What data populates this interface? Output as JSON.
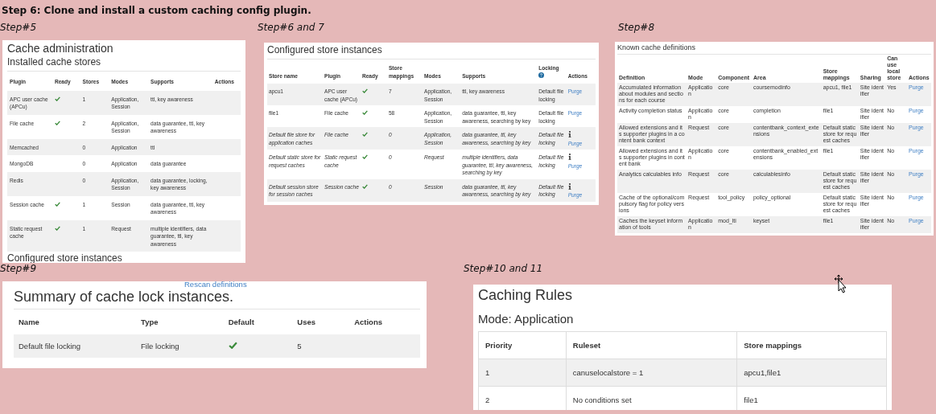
{
  "heading": "Step 6: Clone and install a custom caching config plugin.",
  "step5": {
    "label": "Step#5",
    "title": "Cache administration",
    "subtitle": "Installed cache stores",
    "columns": [
      "Plugin",
      "Ready",
      "Stores",
      "Modes",
      "Supports",
      "Actions"
    ],
    "rows": [
      {
        "plugin": "APC user cache (APCu)",
        "ready": true,
        "stores": "1",
        "modes": "Application, Session",
        "supports": "ttl, key awareness"
      },
      {
        "plugin": "File cache",
        "ready": true,
        "stores": "2",
        "modes": "Application, Session",
        "supports": "data guarantee, ttl, key awareness"
      },
      {
        "plugin": "Memcached",
        "ready": false,
        "stores": "0",
        "modes": "Application",
        "supports": "ttl"
      },
      {
        "plugin": "MongoDB",
        "ready": false,
        "stores": "0",
        "modes": "Application",
        "supports": "data guarantee"
      },
      {
        "plugin": "Redis",
        "ready": false,
        "stores": "0",
        "modes": "Application, Session",
        "supports": "data guarantee, locking, key awareness"
      },
      {
        "plugin": "Session cache",
        "ready": true,
        "stores": "1",
        "modes": "Session",
        "supports": "data guarantee, ttl, key awareness"
      },
      {
        "plugin": "Static request cache",
        "ready": true,
        "stores": "1",
        "modes": "Request",
        "supports": "multiple identifiers, data guarantee, ttl, key awareness"
      }
    ],
    "next_title": "Configured store instances"
  },
  "step6_7": {
    "label": "Step#6 and 7",
    "title": "Configured store instances",
    "columns": [
      "Store name",
      "Plugin",
      "Ready",
      "Store mappings",
      "Modes",
      "Supports",
      "Locking",
      "Actions"
    ],
    "rows": [
      {
        "name": "apcu1",
        "plugin": "APC user cache (APCu)",
        "ready": true,
        "mappings": "7",
        "modes": "Application, Session",
        "supports": "ttl, key awareness",
        "locking": "Default file locking",
        "action": "Purge",
        "is_default": false
      },
      {
        "name": "file1",
        "plugin": "File cache",
        "ready": true,
        "mappings": "58",
        "modes": "Application, Session",
        "supports": "data guarantee, ttl, key awareness, searching by key",
        "locking": "Default file locking",
        "action": "Purge",
        "is_default": false
      },
      {
        "name": "Default file store for application caches",
        "plugin": "File cache",
        "ready": true,
        "mappings": "0",
        "modes": "Application, Session",
        "supports": "data guarantee, ttl, key awareness, searching by key",
        "locking": "Default file locking",
        "action": "Purge",
        "is_default": true
      },
      {
        "name": "Default static store for request caches",
        "plugin": "Static request cache",
        "ready": true,
        "mappings": "0",
        "modes": "Request",
        "supports": "multiple identifiers, data guarantee, ttl, key awareness, searching by key",
        "locking": "Default file locking",
        "action": "Purge",
        "is_default": true
      },
      {
        "name": "Default session store for session caches",
        "plugin": "Session cache",
        "ready": true,
        "mappings": "0",
        "modes": "Session",
        "supports": "data guarantee, ttl, key awareness, searching by key",
        "locking": "Default file locking",
        "action": "Purge",
        "is_default": true
      }
    ]
  },
  "step8": {
    "label": "Step#8",
    "title": "Known cache definitions",
    "columns": [
      "Definition",
      "Mode",
      "Component",
      "Area",
      "Store mappings",
      "Sharing",
      "Can use local store",
      "Actions"
    ],
    "rows": [
      {
        "definition": "Accumulated information about modules and sections for each course",
        "mode": "Application",
        "component": "core",
        "area": "coursemodinfo",
        "mappings": "apcu1, file1",
        "sharing": "Site identifier",
        "local": "Yes",
        "action": "Purge"
      },
      {
        "definition": "Activity completion status",
        "mode": "Application",
        "component": "core",
        "area": "completion",
        "mappings": "file1",
        "sharing": "Site identifier",
        "local": "No",
        "action": "Purge"
      },
      {
        "definition": "Allowed extensions and its supporter plugins in a content bank context",
        "mode": "Request",
        "component": "core",
        "area": "contentbank_context_extensions",
        "mappings": "Default static store for request caches",
        "sharing": "Site identifier",
        "local": "No",
        "action": "Purge"
      },
      {
        "definition": "Allowed extensions and its supporter plugins in content bank",
        "mode": "Application",
        "component": "core",
        "area": "contentbank_enabled_extensions",
        "mappings": "file1",
        "sharing": "Site identifier",
        "local": "No",
        "action": "Purge"
      },
      {
        "definition": "Analytics calculables info",
        "mode": "Request",
        "component": "core",
        "area": "calculablesinfo",
        "mappings": "Default static store for request caches",
        "sharing": "Site identifier",
        "local": "No",
        "action": "Purge"
      },
      {
        "definition": "Cache of the optional/compulsory flag for policy versions",
        "mode": "Request",
        "component": "tool_policy",
        "area": "policy_optional",
        "mappings": "Default static store for request caches",
        "sharing": "Site identifier",
        "local": "No",
        "action": "Purge"
      },
      {
        "definition": "Caches the keyset information of tools",
        "mode": "Application",
        "component": "mod_lti",
        "area": "keyset",
        "mappings": "file1",
        "sharing": "Site identifier",
        "local": "No",
        "action": "Purge"
      }
    ]
  },
  "step9": {
    "label": "Step#9",
    "link": "Rescan definitions",
    "title": "Summary of cache lock instances.",
    "columns": [
      "Name",
      "Type",
      "Default",
      "Uses",
      "Actions"
    ],
    "rows": [
      {
        "name": "Default file locking",
        "type": "File locking",
        "default": true,
        "uses": "5"
      }
    ]
  },
  "step10_11": {
    "label": "Step#10 and 11",
    "title": "Caching Rules",
    "subtitle": "Mode: Application",
    "columns": [
      "Priority",
      "Ruleset",
      "Store mappings"
    ],
    "rows": [
      {
        "priority": "1",
        "ruleset": "canuselocalstore = 1",
        "mappings": "apcu1,file1"
      },
      {
        "priority": "2",
        "ruleset": "No conditions set",
        "mappings": "file1"
      }
    ]
  }
}
